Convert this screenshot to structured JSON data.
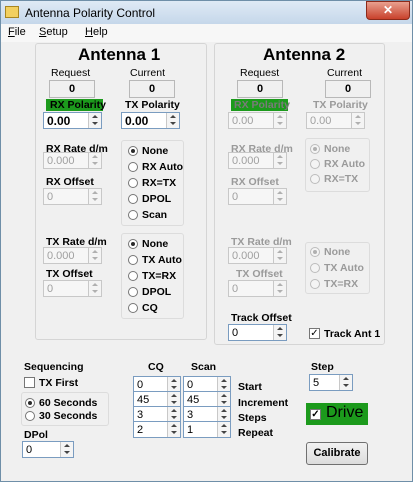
{
  "window": {
    "title": "Antenna Polarity Control",
    "close_glyph": "✕"
  },
  "menu": [
    {
      "key": "F",
      "rest": "ile"
    },
    {
      "key": "S",
      "rest": "etup"
    },
    {
      "key": "H",
      "rest": "elp"
    }
  ],
  "antenna1": {
    "title": "Antenna 1",
    "request_label": "Request",
    "current_label": "Current",
    "request_value": "0",
    "current_value": "0",
    "rx_polarity_label": "RX Polarity",
    "rx_polarity_value": "0.00",
    "tx_polarity_label": "TX Polarity",
    "tx_polarity_value": "0.00",
    "rx_rate_label": "RX Rate d/m",
    "rx_rate_value": "0.000",
    "rx_offset_label": "RX Offset",
    "rx_offset_value": "0",
    "rx_modes": [
      "None",
      "RX Auto",
      "RX=TX",
      "DPOL",
      "Scan"
    ],
    "rx_selected": "None",
    "tx_rate_label": "TX Rate d/m",
    "tx_rate_value": "0.000",
    "tx_offset_label": "TX Offset",
    "tx_offset_value": "0",
    "tx_modes": [
      "None",
      "TX Auto",
      "TX=RX",
      "DPOL",
      "CQ"
    ],
    "tx_selected": "None"
  },
  "antenna2": {
    "title": "Antenna 2",
    "request_label": "Request",
    "current_label": "Current",
    "request_value": "0",
    "current_value": "0",
    "rx_polarity_label": "RX Polarity",
    "rx_polarity_value": "0.00",
    "tx_polarity_label": "TX Polarity",
    "tx_polarity_value": "0.00",
    "rx_rate_label": "RX Rate d/m",
    "rx_rate_value": "0.000",
    "rx_offset_label": "RX Offset",
    "rx_offset_value": "0",
    "rx_modes": [
      "None",
      "RX Auto",
      "RX=TX"
    ],
    "rx_selected": "None",
    "tx_rate_label": "TX Rate d/m",
    "tx_rate_value": "0.000",
    "tx_offset_label": "TX Offset",
    "tx_offset_value": "0",
    "tx_modes": [
      "None",
      "TX Auto",
      "TX=RX"
    ],
    "tx_selected": "None",
    "track_offset_label": "Track Offset",
    "track_offset_value": "0",
    "track_ant1_label": "Track Ant 1",
    "track_ant1_checked": true
  },
  "sequencing": {
    "label": "Sequencing",
    "tx_first_label": "TX First",
    "tx_first_checked": false,
    "options": [
      "60 Seconds",
      "30 Seconds"
    ],
    "selected": "60 Seconds",
    "dpol_label": "DPol",
    "dpol_value": "0"
  },
  "cq_scan": {
    "cq_label": "CQ",
    "scan_label": "Scan",
    "rows": [
      {
        "label": "Start",
        "cq": "0",
        "scan": "0"
      },
      {
        "label": "Increment",
        "cq": "45",
        "scan": "45"
      },
      {
        "label": "Steps",
        "cq": "3",
        "scan": "3"
      },
      {
        "label": "Repeat",
        "cq": "2",
        "scan": "1"
      }
    ]
  },
  "step": {
    "label": "Step",
    "value": "5"
  },
  "drive": {
    "label": "Drive",
    "checked": true
  },
  "calibrate": {
    "label": "Calibrate"
  },
  "colors": {
    "green": "#1c9a1c",
    "window_bg": "#f0f0f0",
    "close_red": "#c8412b"
  },
  "icons": {
    "app": "antenna-app-icon",
    "close": "close-icon",
    "check": "✓"
  }
}
